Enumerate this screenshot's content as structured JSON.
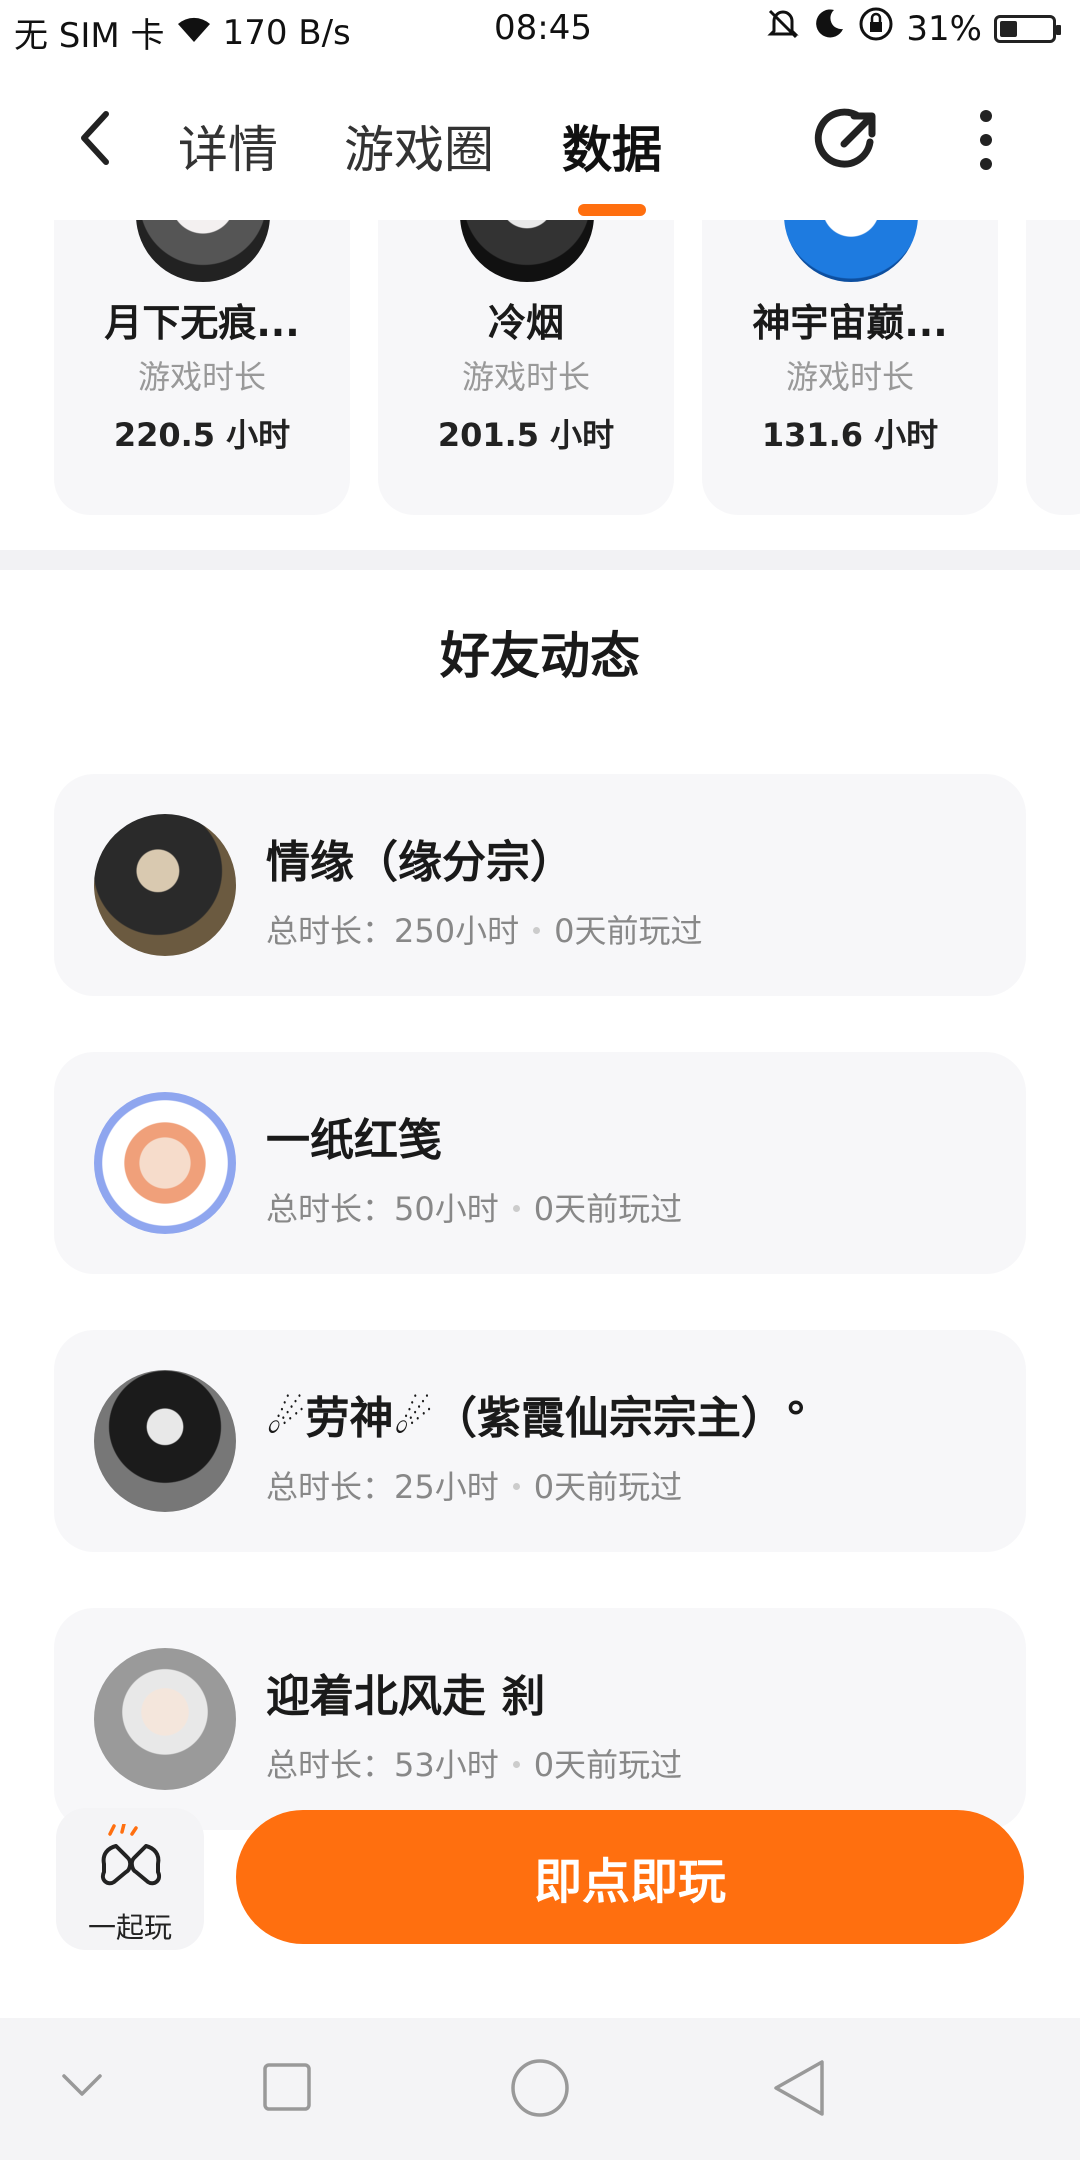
{
  "status": {
    "sim": "无 SIM 卡",
    "net_speed": "170 B/s",
    "time": "08:45",
    "battery": "31%",
    "battery_level": 0.31
  },
  "nav": {
    "tabs": [
      "详情",
      "游戏圈",
      "数据"
    ],
    "active_tab": "数据"
  },
  "top_players": [
    {
      "name": "月下无痕...",
      "label": "游戏时长",
      "hours": "220.5 小时"
    },
    {
      "name": "冷烟",
      "label": "游戏时长",
      "hours": "201.5 小时"
    },
    {
      "name": "神宇宙巅...",
      "label": "游戏时长",
      "hours": "131.6 小时"
    }
  ],
  "section_title": "好友动态",
  "friends": [
    {
      "name": "情缘（缘分宗）",
      "total": "总时长：250小时",
      "last": "0天前玩过"
    },
    {
      "name": "一纸红笺",
      "total": "总时长：50小时",
      "last": "0天前玩过"
    },
    {
      "name": "☄劳神☄（紫霞仙宗宗主）°",
      "total": "总时长：25小时",
      "last": "0天前玩过"
    },
    {
      "name": "迎着北风走 刹",
      "total": "总时长：53小时",
      "last": "0天前玩过"
    }
  ],
  "actions": {
    "together_label": "一起玩",
    "play_label": "即点即玩"
  },
  "colors": {
    "accent": "#ff6f0f",
    "card_bg": "#f7f7f9"
  }
}
